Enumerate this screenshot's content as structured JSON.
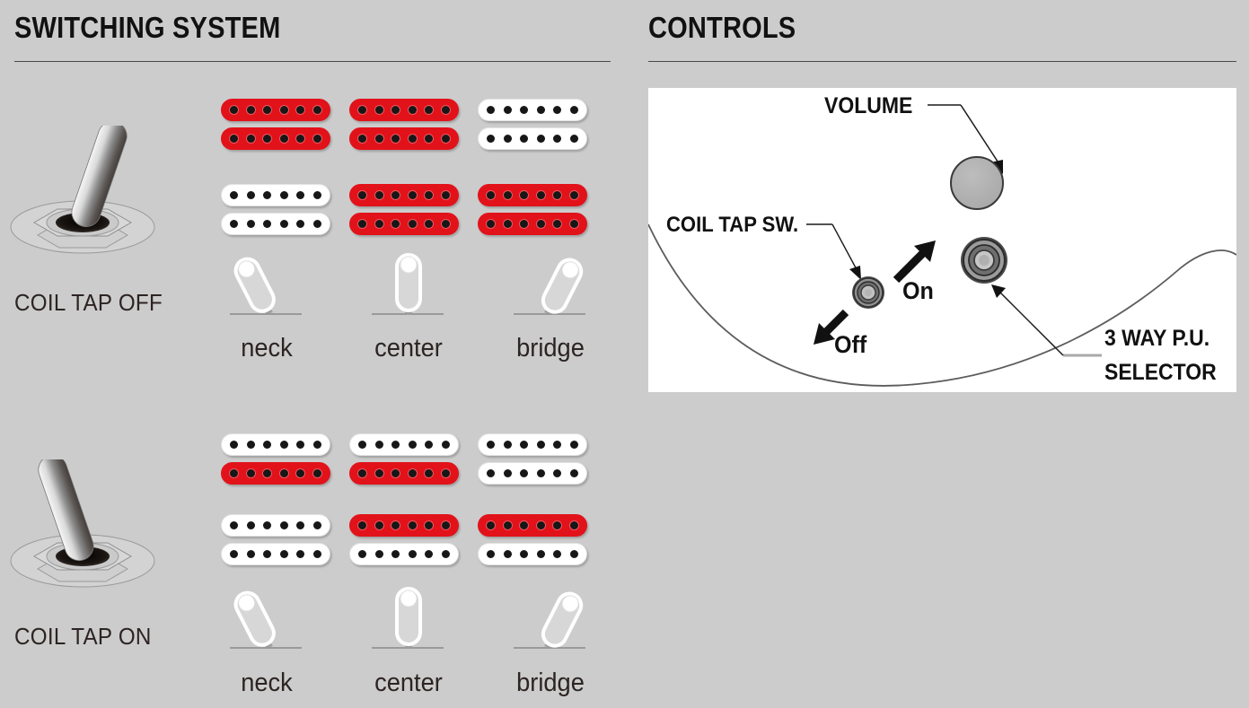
{
  "sections": {
    "switching": {
      "title": "SWITCHING SYSTEM"
    },
    "controls": {
      "title": "CONTROLS"
    }
  },
  "colors": {
    "background": "#cccccc",
    "coil_active": "#e2121a",
    "coil_inactive": "#ffffff",
    "pole_piece": "#171717",
    "panel": "#ffffff",
    "text": "#2c2422",
    "heading": "#111111"
  },
  "switching": {
    "positions": [
      "neck",
      "center",
      "bridge"
    ],
    "modes": [
      {
        "id": "coil-tap-off",
        "label": "COIL TAP OFF",
        "lever_direction": "right",
        "pickups": [
          {
            "position": "neck",
            "neck_pickup": {
              "top_coil": "on",
              "bottom_coil": "on"
            },
            "bridge_pickup": {
              "top_coil": "off",
              "bottom_coil": "off"
            }
          },
          {
            "position": "center",
            "neck_pickup": {
              "top_coil": "on",
              "bottom_coil": "on"
            },
            "bridge_pickup": {
              "top_coil": "on",
              "bottom_coil": "on"
            }
          },
          {
            "position": "bridge",
            "neck_pickup": {
              "top_coil": "off",
              "bottom_coil": "off"
            },
            "bridge_pickup": {
              "top_coil": "on",
              "bottom_coil": "on"
            }
          }
        ]
      },
      {
        "id": "coil-tap-on",
        "label": "COIL TAP ON",
        "lever_direction": "left",
        "pickups": [
          {
            "position": "neck",
            "neck_pickup": {
              "top_coil": "off",
              "bottom_coil": "on"
            },
            "bridge_pickup": {
              "top_coil": "off",
              "bottom_coil": "off"
            }
          },
          {
            "position": "center",
            "neck_pickup": {
              "top_coil": "off",
              "bottom_coil": "on"
            },
            "bridge_pickup": {
              "top_coil": "on",
              "bottom_coil": "off"
            }
          },
          {
            "position": "bridge",
            "neck_pickup": {
              "top_coil": "off",
              "bottom_coil": "off"
            },
            "bridge_pickup": {
              "top_coil": "on",
              "bottom_coil": "off"
            }
          }
        ]
      }
    ],
    "selector_labels": {
      "neck": "neck",
      "center": "center",
      "bridge": "bridge"
    }
  },
  "controls": {
    "callouts": [
      {
        "id": "volume",
        "label": "VOLUME"
      },
      {
        "id": "coil-tap-sw",
        "label": "COIL TAP SW."
      },
      {
        "id": "three-way-selector-line1",
        "label": "3 WAY P.U."
      },
      {
        "id": "three-way-selector-line2",
        "label": "SELECTOR"
      }
    ],
    "switch_directions": [
      {
        "id": "on",
        "label": "On",
        "arrow": "up-right"
      },
      {
        "id": "off",
        "label": "Off",
        "arrow": "down-left"
      }
    ]
  }
}
